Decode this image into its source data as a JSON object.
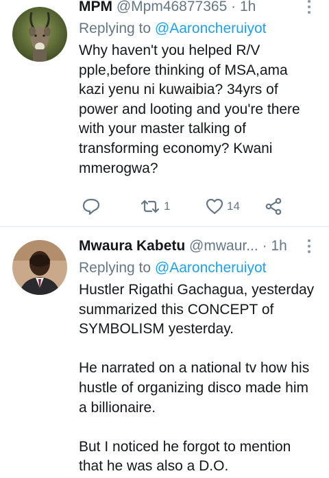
{
  "tweets": [
    {
      "name": "MPM",
      "handle": "@Mpm46877365",
      "dot": "·",
      "time": "1h",
      "replying_prefix": "Replying to ",
      "replying_to": "@Aaroncheruiyot",
      "text": "Why haven't you helped R/V pple,before thinking of MSA,ama kazi yenu ni kuwaibia? 34yrs of power and looting and you're there with your master talking of transforming economy? Kwani mmerogwa?",
      "retweets": "1",
      "likes": "14"
    },
    {
      "name": "Mwaura Kabetu",
      "handle": "@mwaur...",
      "dot": "·",
      "time": "1h",
      "replying_prefix": "Replying to ",
      "replying_to": "@Aaroncheruiyot",
      "text": "Hustler Rigathi Gachagua, yesterday summarized this CONCEPT of SYMBOLISM yesterday.\n\nHe narrated on a national tv how his hustle of organizing disco made him a billionaire.\n\nBut I noticed he forgot to mention that he was also a D.O."
    }
  ],
  "colors": {
    "link": "#1da1f2",
    "secondary": "#657786",
    "primary": "#14171a",
    "divider": "#e1e8ed"
  },
  "icons": {
    "reply": "reply-icon",
    "retweet": "retweet-icon",
    "like": "heart-icon",
    "share": "share-icon",
    "more": "more-vertical-icon"
  }
}
